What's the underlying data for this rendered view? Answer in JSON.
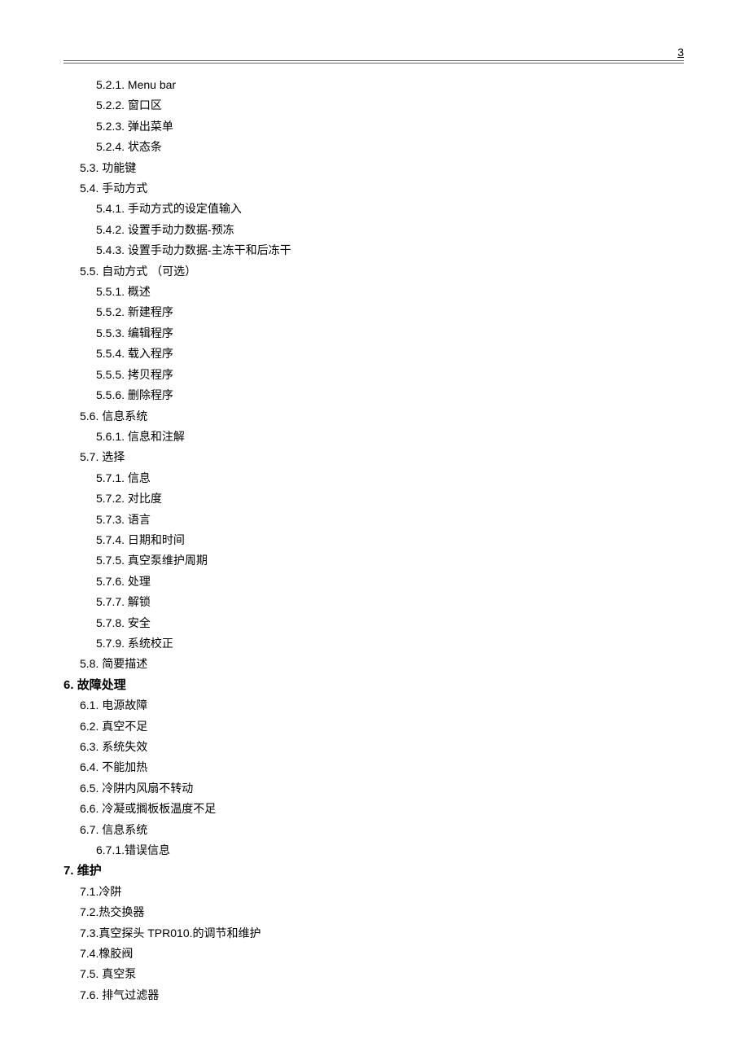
{
  "pageNumber": "3",
  "toc": [
    {
      "lvl": 3,
      "num": "5.2.1.",
      "title": "Menu bar",
      "roman": true
    },
    {
      "lvl": 3,
      "num": "5.2.2.",
      "title": "窗口区"
    },
    {
      "lvl": 3,
      "num": "5.2.3.",
      "title": "弹出菜单"
    },
    {
      "lvl": 3,
      "num": "5.2.4.",
      "title": "状态条"
    },
    {
      "lvl": 2,
      "num": "5.3.",
      "title": "功能键"
    },
    {
      "lvl": 2,
      "num": "5.4.",
      "title": "手动方式"
    },
    {
      "lvl": 3,
      "num": "5.4.1.",
      "title": "手动方式的设定值输入"
    },
    {
      "lvl": 3,
      "num": "5.4.2.",
      "title": "设置手动力数据-预冻"
    },
    {
      "lvl": 3,
      "num": "5.4.3.",
      "title": "设置手动力数据-主冻干和后冻干"
    },
    {
      "lvl": 2,
      "num": "5.5.",
      "title": "自动方式 （可选）"
    },
    {
      "lvl": 3,
      "num": "5.5.1.",
      "title": "概述"
    },
    {
      "lvl": 3,
      "num": "5.5.2.",
      "title": "新建程序"
    },
    {
      "lvl": 3,
      "num": "5.5.3.",
      "title": "编辑程序"
    },
    {
      "lvl": 3,
      "num": "5.5.4.",
      "title": "载入程序"
    },
    {
      "lvl": 3,
      "num": "5.5.5.",
      "title": "拷贝程序"
    },
    {
      "lvl": 3,
      "num": "5.5.6.",
      "title": "删除程序"
    },
    {
      "lvl": 2,
      "num": "5.6.",
      "title": "信息系统"
    },
    {
      "lvl": 3,
      "num": "5.6.1.",
      "title": "信息和注解"
    },
    {
      "lvl": 2,
      "num": "5.7.",
      "title": "选择"
    },
    {
      "lvl": 3,
      "num": "5.7.1.",
      "title": "信息"
    },
    {
      "lvl": 3,
      "num": "5.7.2.",
      "title": "对比度"
    },
    {
      "lvl": 3,
      "num": "5.7.3.",
      "title": "语言"
    },
    {
      "lvl": 3,
      "num": "5.7.4.",
      "title": "日期和时间"
    },
    {
      "lvl": 3,
      "num": "5.7.5.",
      "title": "真空泵维护周期"
    },
    {
      "lvl": 3,
      "num": "5.7.6.",
      "title": "处理"
    },
    {
      "lvl": 3,
      "num": "5.7.7.",
      "title": "解锁"
    },
    {
      "lvl": 3,
      "num": "5.7.8.",
      "title": "安全"
    },
    {
      "lvl": 3,
      "num": "5.7.9.",
      "title": "系统校正"
    },
    {
      "lvl": 2,
      "num": "5.8.",
      "title": "简要描述"
    },
    {
      "lvl": 1,
      "num": "6.",
      "title": "故障处理"
    },
    {
      "lvl": 2,
      "num": "6.1.",
      "title": "电源故障"
    },
    {
      "lvl": 2,
      "num": "6.2.",
      "title": "真空不足"
    },
    {
      "lvl": 2,
      "num": "6.3.",
      "title": "系统失效"
    },
    {
      "lvl": 2,
      "num": "6.4.",
      "title": "不能加热"
    },
    {
      "lvl": 2,
      "num": "6.5.",
      "title": "冷阱内风扇不转动"
    },
    {
      "lvl": 2,
      "num": "6.6.",
      "title": "冷凝或搁板板温度不足"
    },
    {
      "lvl": 2,
      "num": "6.7.",
      "title": "信息系统"
    },
    {
      "lvl": 3,
      "num": "6.7.1.",
      "title": "错误信息",
      "nosep": true
    },
    {
      "lvl": 1,
      "num": "7.",
      "title": "维护"
    },
    {
      "lvl": 2,
      "num": "7.1.",
      "title": "冷阱",
      "nosep": true
    },
    {
      "lvl": 2,
      "num": "7.2.",
      "title": "热交换器",
      "nosep": true
    },
    {
      "lvl": 2,
      "num": "7.3.",
      "title": "真空探头 TPR010.的调节和维护",
      "nosep": true
    },
    {
      "lvl": 2,
      "num": "7.4.",
      "title": "橡胶阀",
      "nosep": true
    },
    {
      "lvl": 2,
      "num": "7.5.",
      "title": "真空泵"
    },
    {
      "lvl": 2,
      "num": "7.6.",
      "title": "排气过滤器"
    }
  ]
}
